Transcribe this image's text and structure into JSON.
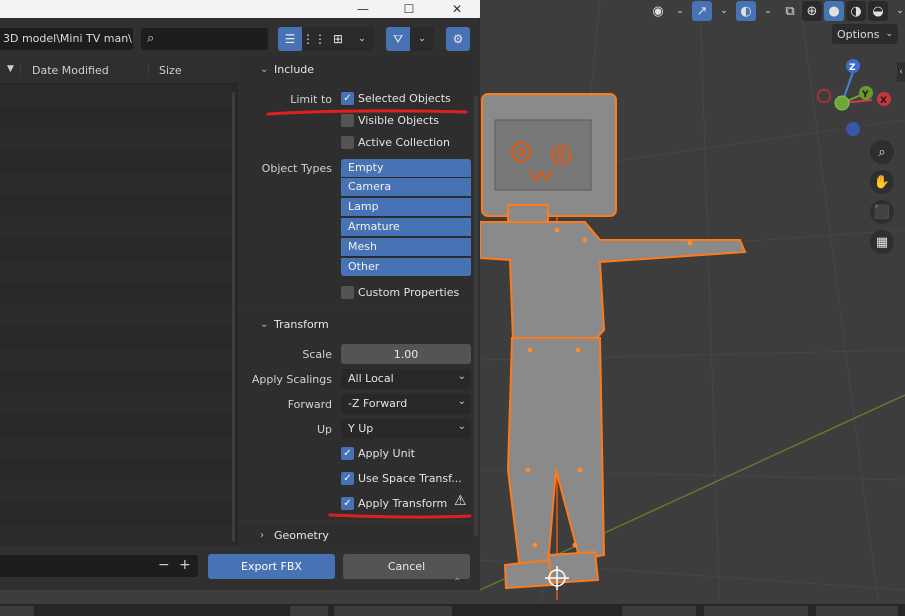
{
  "dialog": {
    "path": "3D model\\Mini TV man\\",
    "search_placeholder": "",
    "columns": {
      "date": "Date Modified",
      "size": "Size"
    }
  },
  "include": {
    "header": "Include",
    "limit_to_label": "Limit to",
    "selected_objects": "Selected Objects",
    "visible_objects": "Visible Objects",
    "active_collection": "Active Collection",
    "object_types_label": "Object Types",
    "object_types": [
      "Empty",
      "Camera",
      "Lamp",
      "Armature",
      "Mesh",
      "Other"
    ],
    "custom_properties": "Custom Properties"
  },
  "transform": {
    "header": "Transform",
    "scale_label": "Scale",
    "scale_value": "1.00",
    "apply_scalings_label": "Apply Scalings",
    "apply_scalings_value": "All Local",
    "forward_label": "Forward",
    "forward_value": "-Z Forward",
    "up_label": "Up",
    "up_value": "Y Up",
    "apply_unit": "Apply Unit",
    "use_space_transform": "Use Space Transf...",
    "apply_transform": "Apply Transform"
  },
  "geometry": {
    "header": "Geometry"
  },
  "actions": {
    "export": "Export FBX",
    "cancel": "Cancel"
  },
  "viewport": {
    "options_label": "Options",
    "gizmo": {
      "z": "Z",
      "y": "Y",
      "x": "X"
    }
  },
  "colors": {
    "accent": "#4772b3",
    "annotation_red": "#e02020",
    "selection_orange": "#ff7a1a"
  }
}
